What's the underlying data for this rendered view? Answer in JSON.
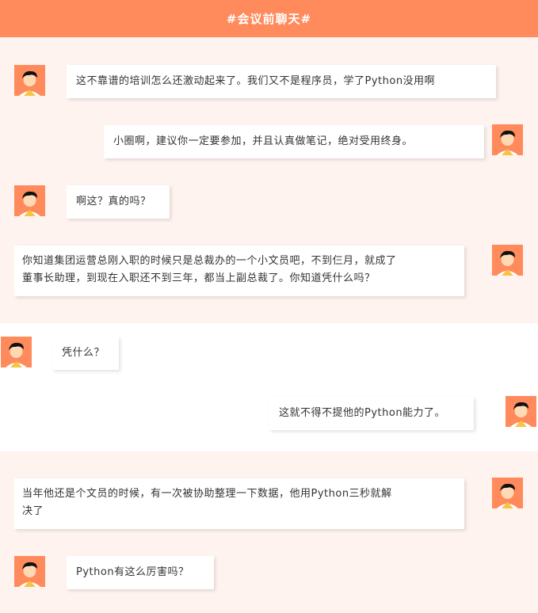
{
  "header": {
    "title": "#会议前聊天#"
  },
  "messages": [
    {
      "side": "left",
      "avatar": "person-avatar",
      "text": "这不靠谱的培训怎么还激动起来了。我们又不是程序员，学了Python没用啊"
    },
    {
      "side": "right",
      "avatar": "person-avatar",
      "text": "小圈啊，建议你一定要参加，并且认真做笔记，绝对受用终身。"
    },
    {
      "side": "left",
      "avatar": "person-avatar",
      "text": "啊这？真的吗？"
    },
    {
      "side": "right",
      "avatar": "person-avatar",
      "lines": [
        "你知道集团运营总刚入职的时候只是总裁办的一个小文员吧，不到仨月，就成了",
        "董事长助理，到现在入职还不到三年，都当上副总裁了。你知道凭什么吗？"
      ]
    },
    {
      "side": "left",
      "avatar": "person-avatar",
      "text": "凭什么？"
    },
    {
      "side": "right",
      "avatar": "person-avatar",
      "text": "这就不得不提他的Python能力了。"
    },
    {
      "side": "right",
      "avatar": "person-avatar",
      "lines": [
        "当年他还是个文员的时候，有一次被协助整理一下数据，他用Python三秒就解",
        "决了"
      ]
    },
    {
      "side": "left",
      "avatar": "person-avatar",
      "text": "Python有这么厉害吗？"
    }
  ],
  "colors": {
    "accent": "#ff8a5c",
    "panel": "#fff3ef",
    "bubble": "#ffffff"
  }
}
